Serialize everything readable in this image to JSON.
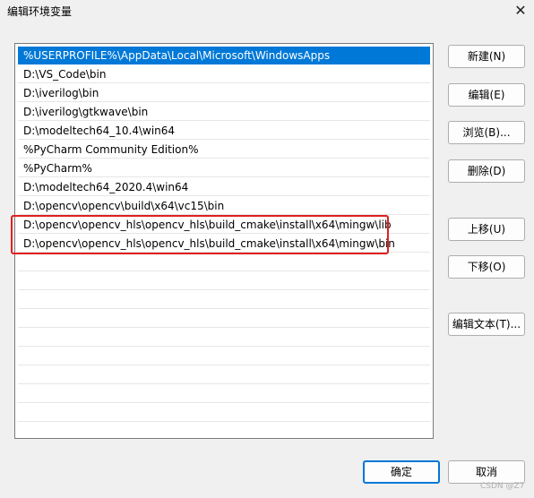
{
  "window": {
    "title": "编辑环境变量",
    "close_glyph": "✕"
  },
  "paths": [
    "%USERPROFILE%\\AppData\\Local\\Microsoft\\WindowsApps",
    "D:\\VS_Code\\bin",
    "D:\\iverilog\\bin",
    "D:\\iverilog\\gtkwave\\bin",
    "D:\\modeltech64_10.4\\win64",
    "%PyCharm Community Edition%",
    "%PyCharm%",
    "D:\\modeltech64_2020.4\\win64",
    "D:\\opencv\\opencv\\build\\x64\\vc15\\bin",
    "D:\\opencv\\opencv_hls\\opencv_hls\\build_cmake\\install\\x64\\mingw\\lib",
    "D:\\opencv\\opencv_hls\\opencv_hls\\build_cmake\\install\\x64\\mingw\\bin"
  ],
  "selected_index": 0,
  "buttons": {
    "new": "新建(N)",
    "edit": "编辑(E)",
    "browse": "浏览(B)...",
    "delete": "删除(D)",
    "move_up": "上移(U)",
    "move_down": "下移(O)",
    "edit_text": "编辑文本(T)...",
    "ok": "确定",
    "cancel": "取消"
  },
  "colors": {
    "selection": "#0078d7",
    "annotation": "#e02020"
  },
  "watermark": "CSDN @Z7"
}
